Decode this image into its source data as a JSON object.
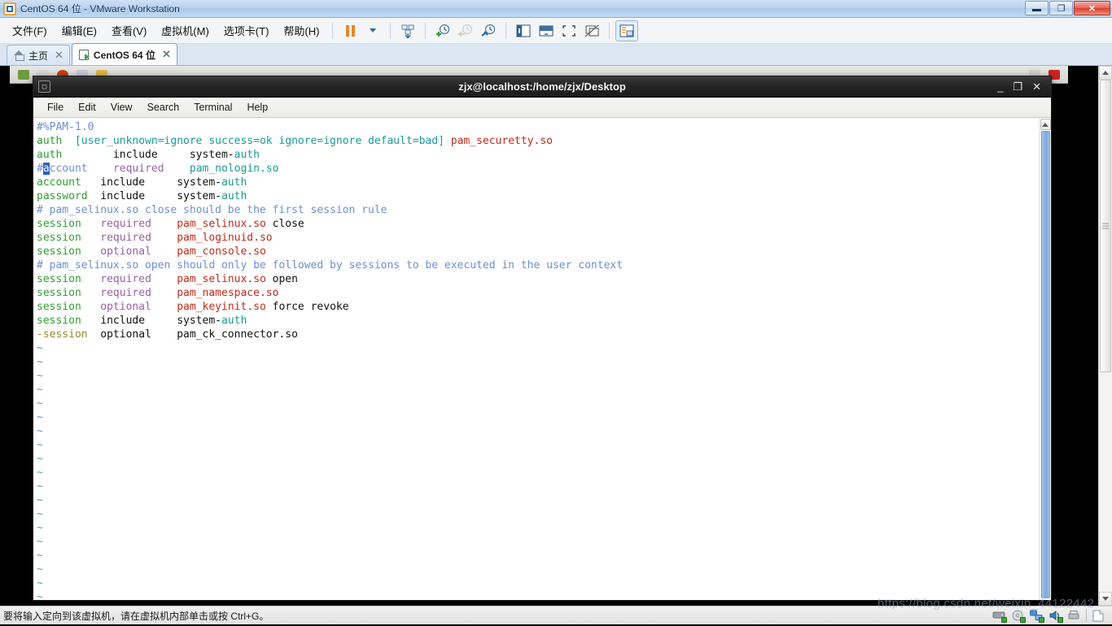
{
  "window": {
    "title": "CentOS 64 位 - VMware Workstation",
    "app_icon": "vmware-logo-icon",
    "controls": {
      "minimize": "–",
      "restore": "❐",
      "close": "✕"
    }
  },
  "menubar": {
    "items": [
      {
        "label": "文件(F)",
        "name": "menu-file"
      },
      {
        "label": "编辑(E)",
        "name": "menu-edit"
      },
      {
        "label": "查看(V)",
        "name": "menu-view"
      },
      {
        "label": "虚拟机(M)",
        "name": "menu-vm"
      },
      {
        "label": "选项卡(T)",
        "name": "menu-tabs"
      },
      {
        "label": "帮助(H)",
        "name": "menu-help"
      }
    ],
    "toolbar": [
      {
        "name": "pause-button",
        "icon": "pause-icon"
      },
      {
        "name": "power-dropdown-button",
        "icon": "chevron-down-icon"
      },
      {
        "name": "send-ctrl-alt-del-button",
        "icon": "keyboard-send-icon"
      },
      {
        "name": "take-snapshot-button",
        "icon": "snapshot-add-icon"
      },
      {
        "name": "revert-snapshot-button",
        "icon": "snapshot-revert-icon"
      },
      {
        "name": "snapshot-manager-button",
        "icon": "snapshot-manager-icon"
      },
      {
        "name": "show-sidebar-button",
        "icon": "sidebar-toggle-icon"
      },
      {
        "name": "show-thumbnail-bar-button",
        "icon": "thumbnail-bar-icon"
      },
      {
        "name": "full-screen-button",
        "icon": "fullscreen-icon"
      },
      {
        "name": "unity-mode-button",
        "icon": "unity-mode-icon"
      },
      {
        "name": "console-view-button",
        "icon": "console-view-icon"
      }
    ]
  },
  "tabs": [
    {
      "label": "主页",
      "icon": "home-icon",
      "active": false,
      "close": "✕"
    },
    {
      "label": "CentOS 64 位",
      "icon": "vm-powered-on-icon",
      "active": true,
      "close": "✕"
    }
  ],
  "terminal": {
    "title": "zjx@localhost:/home/zjx/Desktop",
    "icon": "terminal-icon",
    "controls": {
      "minimize": "_",
      "maximize": "❐",
      "close": "✕"
    },
    "menu": [
      "File",
      "Edit",
      "View",
      "Search",
      "Terminal",
      "Help"
    ],
    "editor": "vim",
    "tilde_count": 19,
    "cursor": {
      "line": 4,
      "col": 2,
      "char": "a"
    },
    "lines": [
      [
        {
          "t": "#%PAM-1.0",
          "c": "c-blue"
        }
      ],
      [
        {
          "t": "auth",
          "c": "c-green"
        },
        {
          "t": "  ",
          "c": "c-black"
        },
        {
          "t": "[user_unknown=ignore success=ok ignore=ignore default=bad]",
          "c": "c-teal"
        },
        {
          "t": " ",
          "c": "c-black"
        },
        {
          "t": "pam_securetty.so",
          "c": "c-red"
        }
      ],
      [
        {
          "t": "auth",
          "c": "c-green"
        },
        {
          "t": "        include     system-",
          "c": "c-black"
        },
        {
          "t": "auth",
          "c": "c-teal"
        }
      ],
      [
        {
          "t": "#",
          "c": "c-blue"
        },
        {
          "t": "a",
          "c": "cursor"
        },
        {
          "t": "ccount",
          "c": "c-blue"
        },
        {
          "t": "    ",
          "c": "c-black"
        },
        {
          "t": "required",
          "c": "c-purple"
        },
        {
          "t": "    ",
          "c": "c-black"
        },
        {
          "t": "pam_nologin.so",
          "c": "c-teal"
        }
      ],
      [
        {
          "t": "account",
          "c": "c-green"
        },
        {
          "t": "   include     system-",
          "c": "c-black"
        },
        {
          "t": "auth",
          "c": "c-teal"
        }
      ],
      [
        {
          "t": "password",
          "c": "c-green"
        },
        {
          "t": "  include     system-",
          "c": "c-black"
        },
        {
          "t": "auth",
          "c": "c-teal"
        }
      ],
      [
        {
          "t": "# pam_selinux.so close should be the first session rule",
          "c": "c-blue"
        }
      ],
      [
        {
          "t": "session",
          "c": "c-green"
        },
        {
          "t": "   ",
          "c": "c-black"
        },
        {
          "t": "required",
          "c": "c-purple"
        },
        {
          "t": "    ",
          "c": "c-black"
        },
        {
          "t": "pam_selinux.so",
          "c": "c-red"
        },
        {
          "t": " close",
          "c": "c-black"
        }
      ],
      [
        {
          "t": "session",
          "c": "c-green"
        },
        {
          "t": "   ",
          "c": "c-black"
        },
        {
          "t": "required",
          "c": "c-purple"
        },
        {
          "t": "    ",
          "c": "c-black"
        },
        {
          "t": "pam_loginuid.so",
          "c": "c-red"
        }
      ],
      [
        {
          "t": "session",
          "c": "c-green"
        },
        {
          "t": "   ",
          "c": "c-black"
        },
        {
          "t": "optional",
          "c": "c-purple"
        },
        {
          "t": "    ",
          "c": "c-black"
        },
        {
          "t": "pam_console.so",
          "c": "c-red"
        }
      ],
      [
        {
          "t": "# pam_selinux.so open should only be followed by sessions to be executed in the user context",
          "c": "c-blue"
        }
      ],
      [
        {
          "t": "session",
          "c": "c-green"
        },
        {
          "t": "   ",
          "c": "c-black"
        },
        {
          "t": "required",
          "c": "c-purple"
        },
        {
          "t": "    ",
          "c": "c-black"
        },
        {
          "t": "pam_selinux.so",
          "c": "c-red"
        },
        {
          "t": " open",
          "c": "c-black"
        }
      ],
      [
        {
          "t": "session",
          "c": "c-green"
        },
        {
          "t": "   ",
          "c": "c-black"
        },
        {
          "t": "required",
          "c": "c-purple"
        },
        {
          "t": "    ",
          "c": "c-black"
        },
        {
          "t": "pam_namespace.so",
          "c": "c-red"
        }
      ],
      [
        {
          "t": "session",
          "c": "c-green"
        },
        {
          "t": "   ",
          "c": "c-black"
        },
        {
          "t": "optional",
          "c": "c-purple"
        },
        {
          "t": "    ",
          "c": "c-black"
        },
        {
          "t": "pam_keyinit.so",
          "c": "c-red"
        },
        {
          "t": " force revoke",
          "c": "c-black"
        }
      ],
      [
        {
          "t": "session",
          "c": "c-green"
        },
        {
          "t": "   include     system-",
          "c": "c-black"
        },
        {
          "t": "auth",
          "c": "c-teal"
        }
      ],
      [
        {
          "t": "-session",
          "c": "c-olive"
        },
        {
          "t": "  optional    pam_ck_connector.so",
          "c": "c-black"
        }
      ]
    ]
  },
  "statusbar": {
    "message": "要将输入定向到该虚拟机，请在虚拟机内部单击或按 Ctrl+G。",
    "watermark": "https://blog.csdn.net/weixin_44122442",
    "device_icons": [
      {
        "name": "hard-disk-icon",
        "color": "#8a9099"
      },
      {
        "name": "cd-dvd-icon",
        "color": "#cfd4da"
      },
      {
        "name": "network-adapter-icon",
        "color": "#4a90d9"
      },
      {
        "name": "sound-card-icon",
        "color": "#3c7fc0"
      },
      {
        "name": "printer-icon",
        "color": "#b9bec4"
      },
      {
        "name": "message-log-icon",
        "color": "#ffffff"
      }
    ]
  },
  "colors": {
    "accent": "#2a5fc9",
    "comment": "#6b8fd4",
    "keyword_green": "#2f9e2f",
    "control_purple": "#9a5fa8",
    "module_red": "#c42b1c",
    "string_teal": "#1a9a9a",
    "olive": "#9a8a2a",
    "close_red": "#d8402f"
  }
}
